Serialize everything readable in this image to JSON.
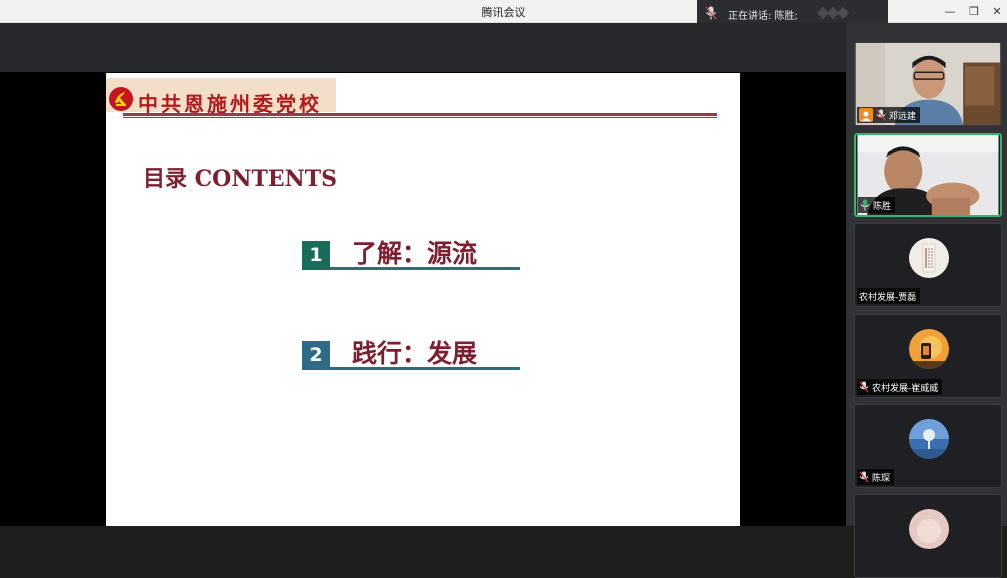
{
  "window": {
    "title": "腾讯会议",
    "controls": {
      "minimize": "—",
      "restore": "❐",
      "close": "✕"
    }
  },
  "speaking": {
    "text": "正在讲话: 陈胜;"
  },
  "slide": {
    "logo_text": "中共恩施州委党校",
    "contents_title": "目录  CONTENTS",
    "items": [
      {
        "number": "1",
        "label": "了解：源流",
        "color": "#1b6b5a"
      },
      {
        "number": "2",
        "label": "践行：发展",
        "color": "#2e6b86"
      }
    ]
  },
  "participants": [
    {
      "name": "邓远建",
      "host": true,
      "mic": "muted",
      "video": true
    },
    {
      "name": "陈胜",
      "host": false,
      "mic": "active",
      "video": true,
      "speaking": true
    },
    {
      "name": "农村发展-贾磊",
      "host": false,
      "mic": "none",
      "video": false
    },
    {
      "name": "农村发展-崔威威",
      "host": false,
      "mic": "muted",
      "video": false
    },
    {
      "name": "陈琛",
      "host": false,
      "mic": "muted",
      "video": false
    }
  ],
  "colors": {
    "accent_green": "#33b56b",
    "slide_red": "#7e1f31",
    "logo_red": "#b21b1b"
  }
}
